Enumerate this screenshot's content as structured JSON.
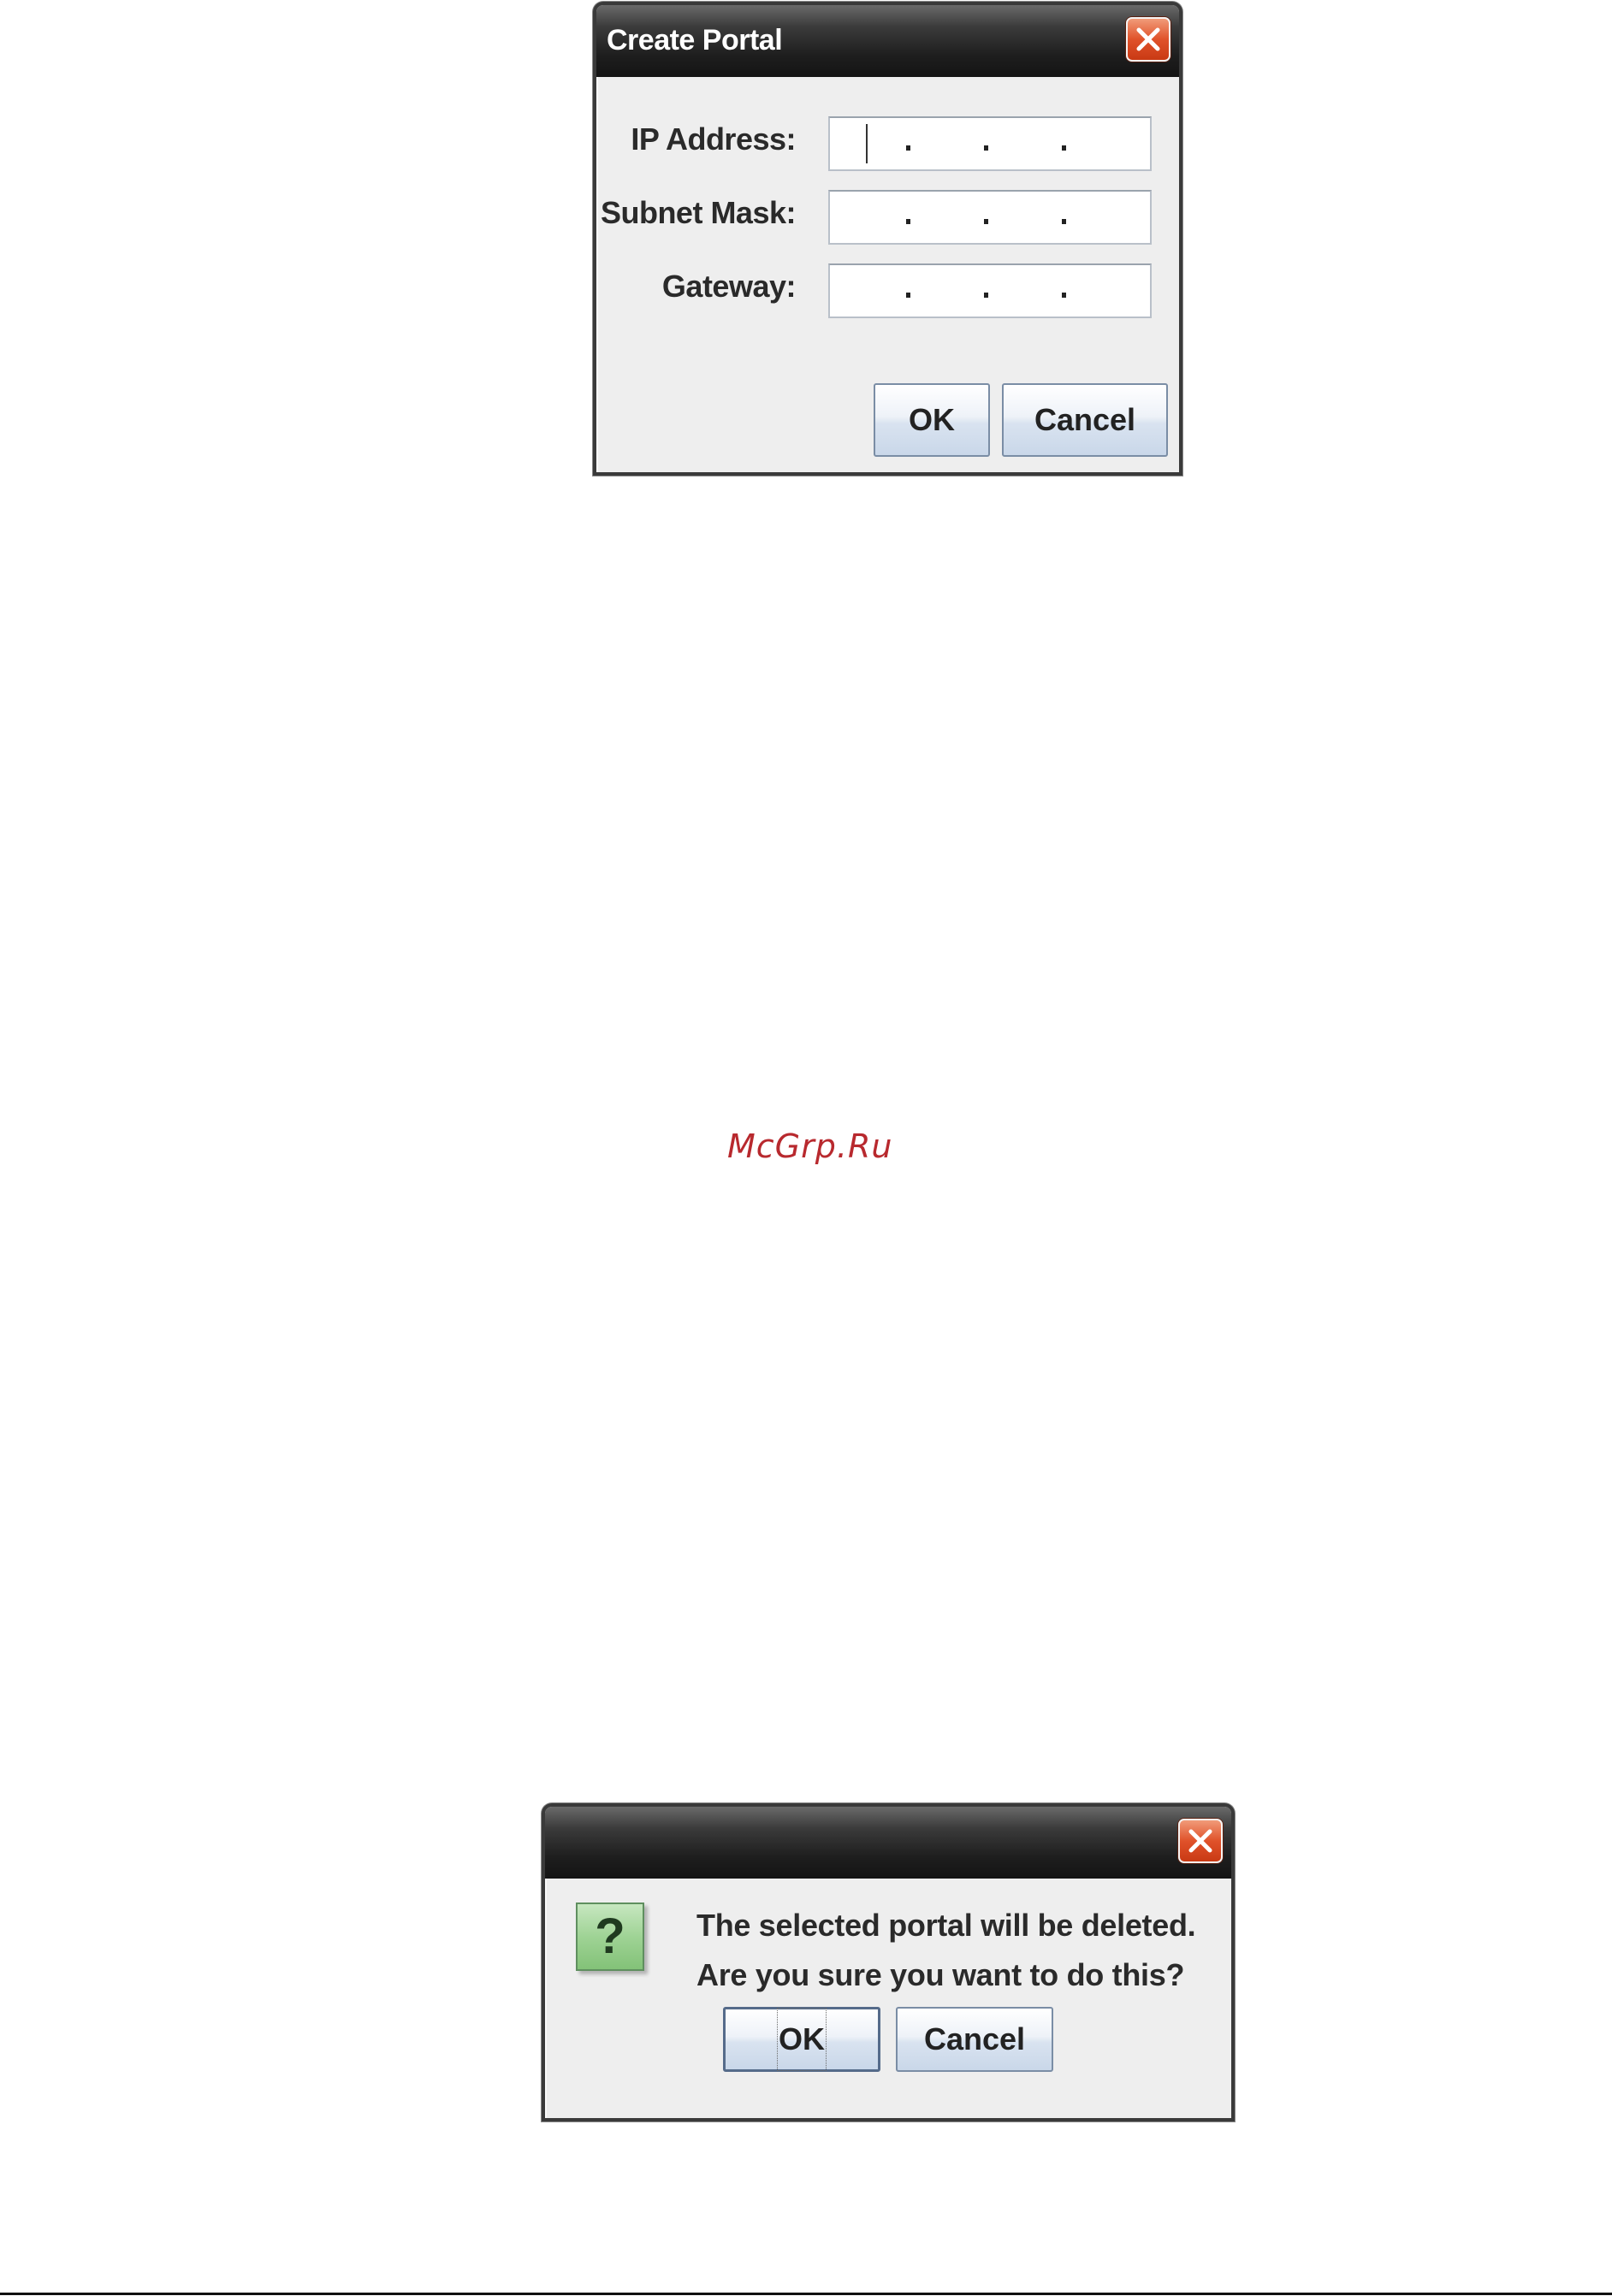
{
  "create_portal_dialog": {
    "title": "Create Portal",
    "fields": [
      {
        "label": "IP Address:",
        "value": "",
        "dots": ".",
        "has_caret": true
      },
      {
        "label": "Subnet Mask:",
        "value": "",
        "dots": ".",
        "has_caret": false
      },
      {
        "label": "Gateway:",
        "value": "",
        "dots": ".",
        "has_caret": false
      }
    ],
    "ok_label": "OK",
    "cancel_label": "Cancel"
  },
  "confirm_delete_dialog": {
    "title": "",
    "icon_glyph": "?",
    "icon": "question-icon",
    "message_line_1": "The selected portal will be deleted.",
    "message_line_2": "Are you sure you want to do this?",
    "ok_label": "OK",
    "cancel_label": "Cancel"
  },
  "watermark": "McGrp.Ru",
  "colors": {
    "titlebar": "#1e1e1e",
    "close_button": "#e0522a",
    "dialog_background": "#eeeeee",
    "watermark": "#b8292e"
  }
}
